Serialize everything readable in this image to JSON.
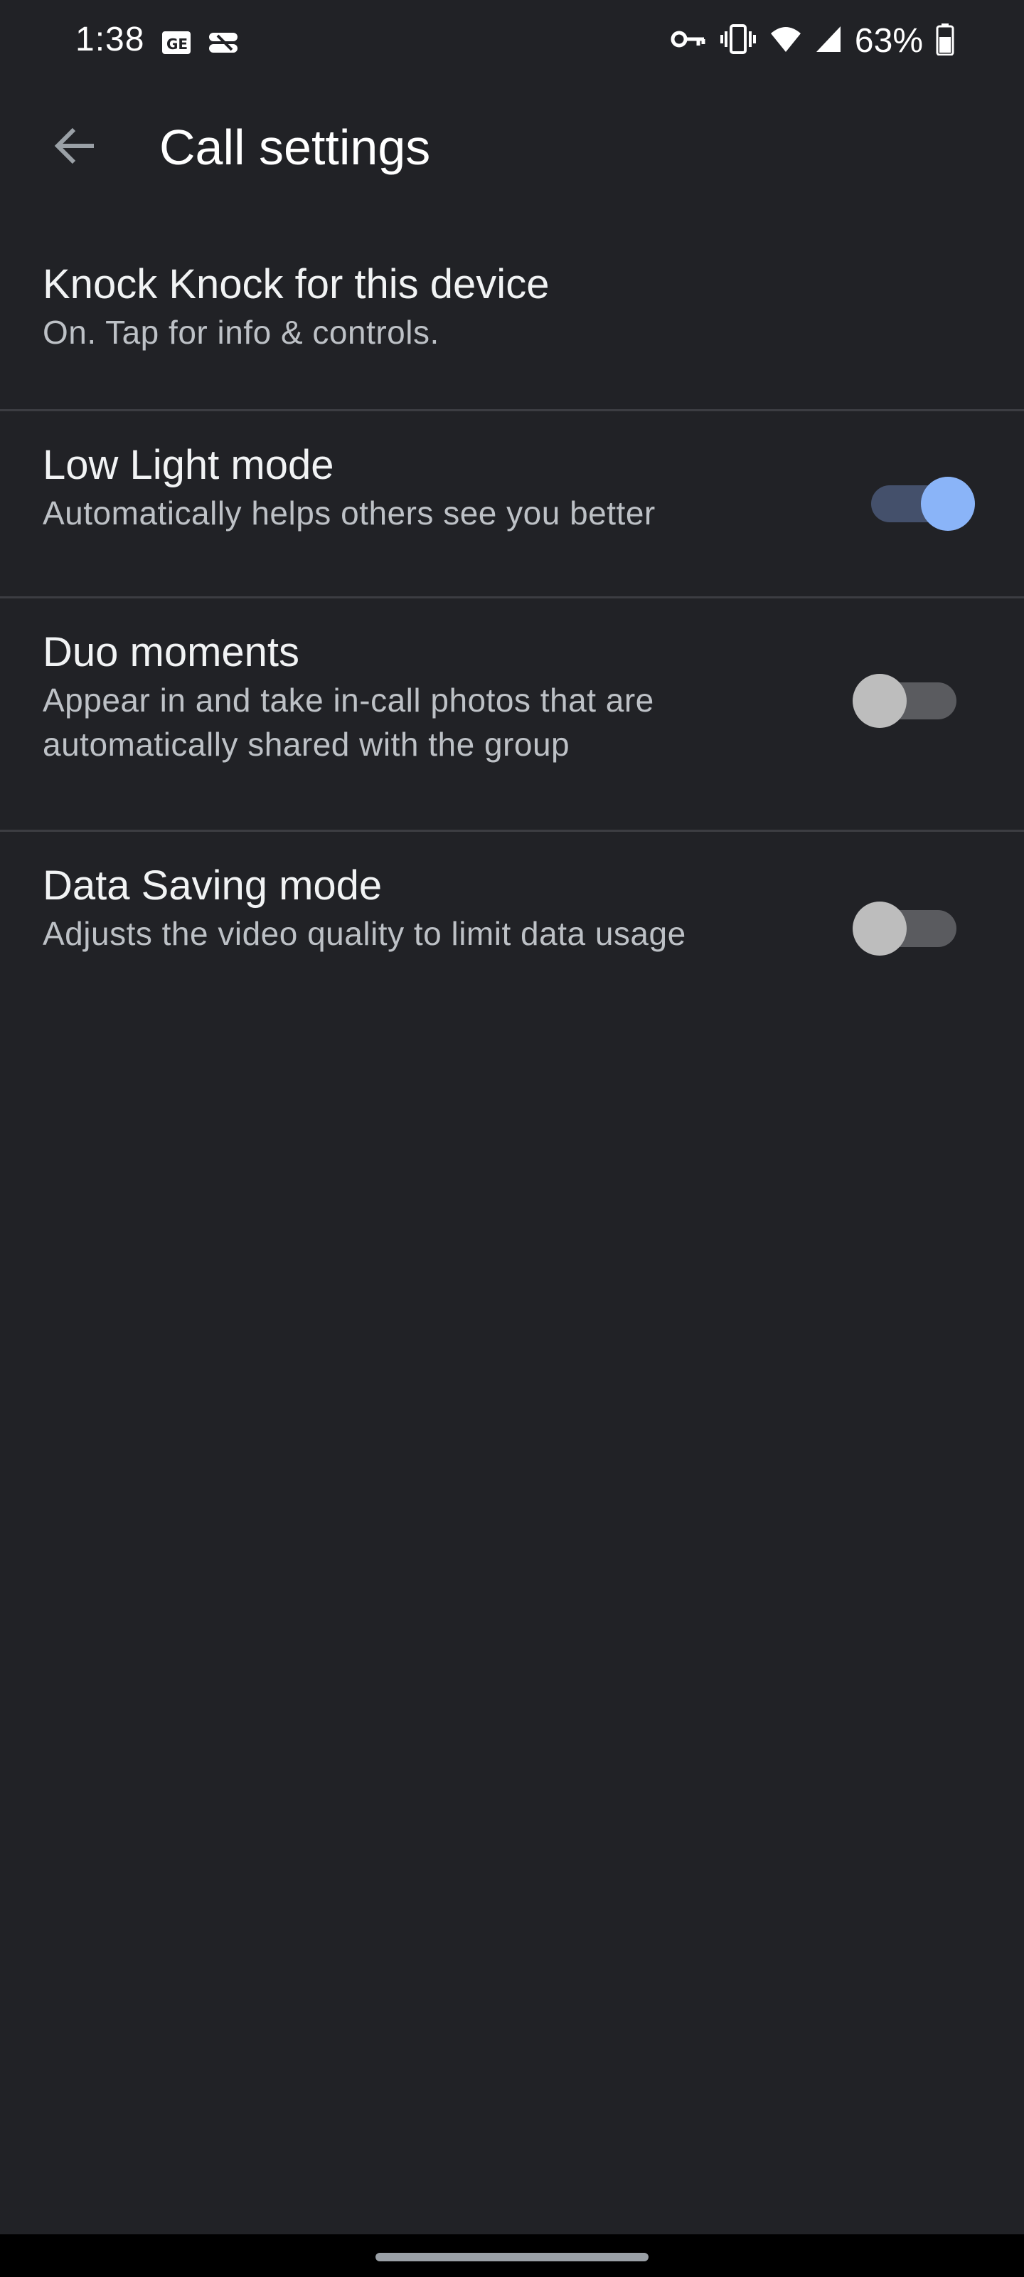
{
  "status_bar": {
    "time": "1:38",
    "battery_percent": "63%",
    "left_icons": [
      "news-icon",
      "dropbox-icon"
    ],
    "right_icons": [
      "vpn-key-icon",
      "vibrate-icon",
      "wifi-icon",
      "cell-signal-icon",
      "battery-icon"
    ]
  },
  "app_bar": {
    "title": "Call settings",
    "back_icon": "arrow-back-icon"
  },
  "settings": [
    {
      "title": "Knock Knock for this device",
      "subtitle": "On. Tap for info & controls."
    },
    {
      "title": "Low Light mode",
      "subtitle": "Automatically helps others see you better",
      "toggle_on": true
    },
    {
      "title": "Duo moments",
      "subtitle": "Appear in and take in-call photos that are automatically shared with the group",
      "toggle_on": false
    },
    {
      "title": "Data Saving mode",
      "subtitle": "Adjusts the video quality to limit data usage",
      "toggle_on": false
    }
  ],
  "colors": {
    "background": "#212226",
    "accent": "#8ab4f8",
    "divider": "#3c3d42"
  }
}
